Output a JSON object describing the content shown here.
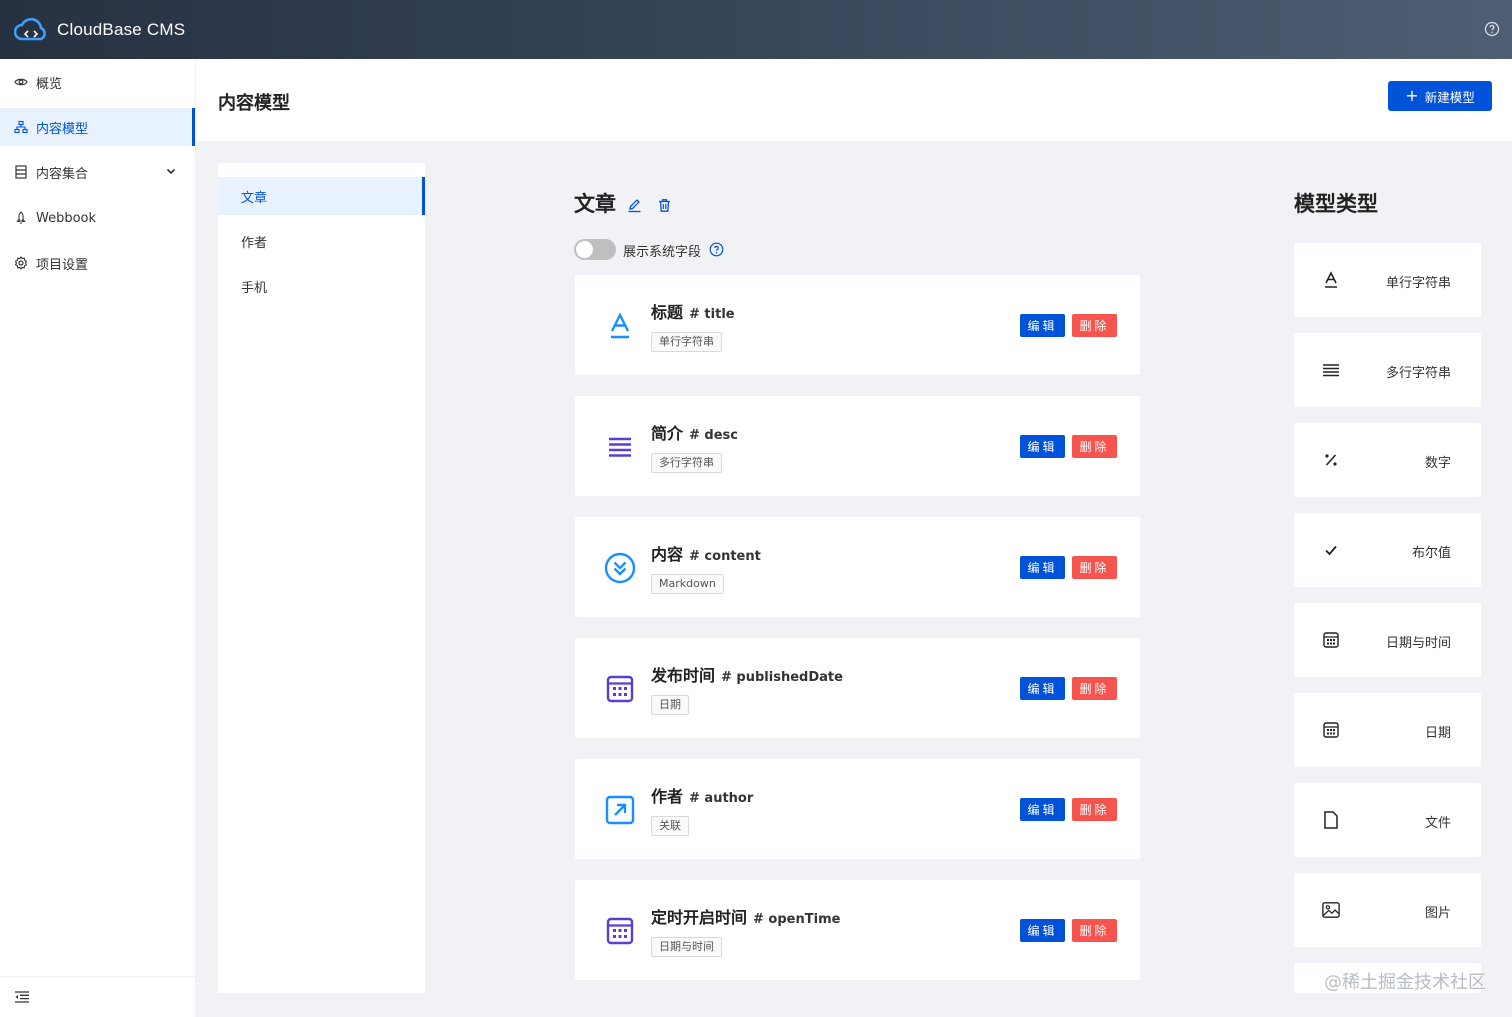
{
  "app": {
    "title": "CloudBase CMS",
    "accent": "#0052d9",
    "danger": "#f5544f"
  },
  "sidebar": {
    "items": [
      {
        "label": "概览",
        "icon": "eye-icon"
      },
      {
        "label": "内容模型",
        "icon": "sitemap-icon",
        "active": true
      },
      {
        "label": "内容集合",
        "icon": "database-icon"
      },
      {
        "label": "Webbook",
        "icon": "rocket-icon"
      },
      {
        "label": "项目设置",
        "icon": "gear-icon"
      }
    ]
  },
  "header": {
    "title": "内容模型",
    "new_button": "新建模型"
  },
  "models": {
    "items": [
      "文章",
      "作者",
      "手机"
    ],
    "selected": "文章"
  },
  "current_model": {
    "name": "文章",
    "toggle_label": "展示系统字段",
    "toggle_on": false
  },
  "actions": {
    "edit": "编辑",
    "delete": "删除"
  },
  "fields": [
    {
      "name": "标题",
      "key": "# title",
      "type": "单行字符串",
      "icon": "text-a-icon"
    },
    {
      "name": "简介",
      "key": "# desc",
      "type": "多行字符串",
      "icon": "lines-icon"
    },
    {
      "name": "内容",
      "key": "# content",
      "type": "Markdown",
      "icon": "markdown-icon"
    },
    {
      "name": "发布时间",
      "key": "# publishedDate",
      "type": "日期",
      "icon": "calendar-icon"
    },
    {
      "name": "作者",
      "key": "# author",
      "type": "关联",
      "icon": "link-arrow-icon"
    },
    {
      "name": "定时开启时间",
      "key": "# openTime",
      "type": "日期与时间",
      "icon": "calendar-icon"
    }
  ],
  "types": {
    "title": "模型类型",
    "items": [
      {
        "label": "单行字符串",
        "icon": "text-a-icon"
      },
      {
        "label": "多行字符串",
        "icon": "lines-icon"
      },
      {
        "label": "数字",
        "icon": "percent-icon"
      },
      {
        "label": "布尔值",
        "icon": "check-icon"
      },
      {
        "label": "日期与时间",
        "icon": "calendar-icon"
      },
      {
        "label": "日期",
        "icon": "calendar-icon"
      },
      {
        "label": "文件",
        "icon": "file-icon"
      },
      {
        "label": "图片",
        "icon": "image-icon"
      }
    ]
  },
  "watermark": "@稀土掘金技术社区"
}
